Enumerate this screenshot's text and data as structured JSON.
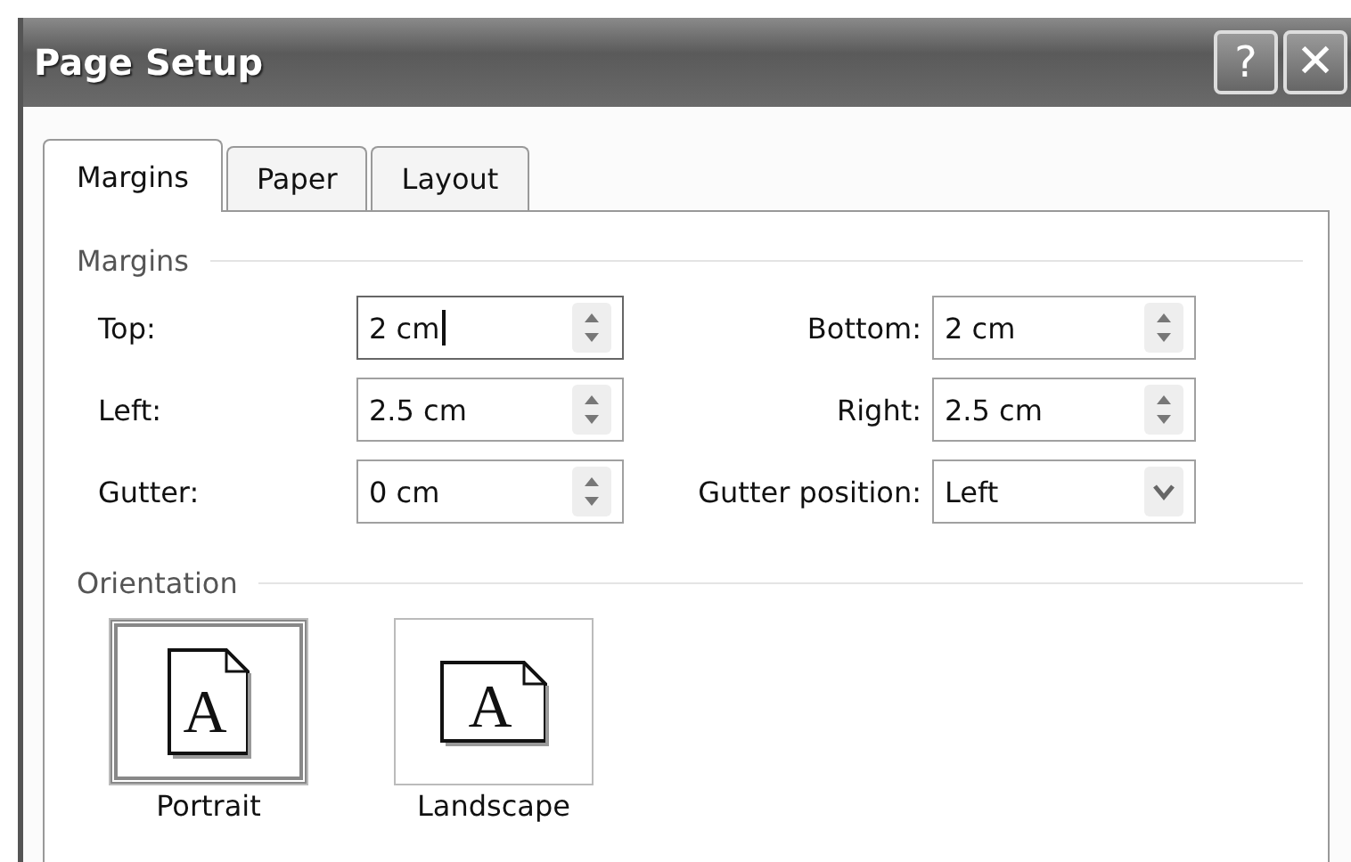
{
  "window": {
    "title": "Page Setup",
    "buttons": [
      {
        "kind": "help",
        "label": "?"
      },
      {
        "kind": "close",
        "label": "✕"
      }
    ]
  },
  "tabs": [
    {
      "label": "Margins",
      "selected": true
    },
    {
      "label": "Paper",
      "selected": false
    },
    {
      "label": "Layout",
      "selected": false
    }
  ],
  "margins": {
    "heading": "Margins",
    "fields": [
      {
        "label": "Top:",
        "value": "2 cm",
        "kind": "spin",
        "focused": true
      },
      {
        "label": "Bottom:",
        "value": "2 cm",
        "kind": "spin",
        "focused": false
      },
      {
        "label": "Left:",
        "value": "2.5 cm",
        "kind": "spin",
        "focused": false
      },
      {
        "label": "Right:",
        "value": "2.5 cm",
        "kind": "spin",
        "focused": false
      },
      {
        "label": "Gutter:",
        "value": "0 cm",
        "kind": "spin",
        "focused": false
      },
      {
        "label": "Gutter position:",
        "value": "Left",
        "kind": "dropdown",
        "focused": false
      }
    ]
  },
  "orientation": {
    "heading": "Orientation",
    "options": [
      {
        "label": "Portrait",
        "kind": "portrait",
        "glyph": "A",
        "selected": true
      },
      {
        "label": "Landscape",
        "kind": "landscape",
        "glyph": "A",
        "selected": false
      }
    ]
  }
}
